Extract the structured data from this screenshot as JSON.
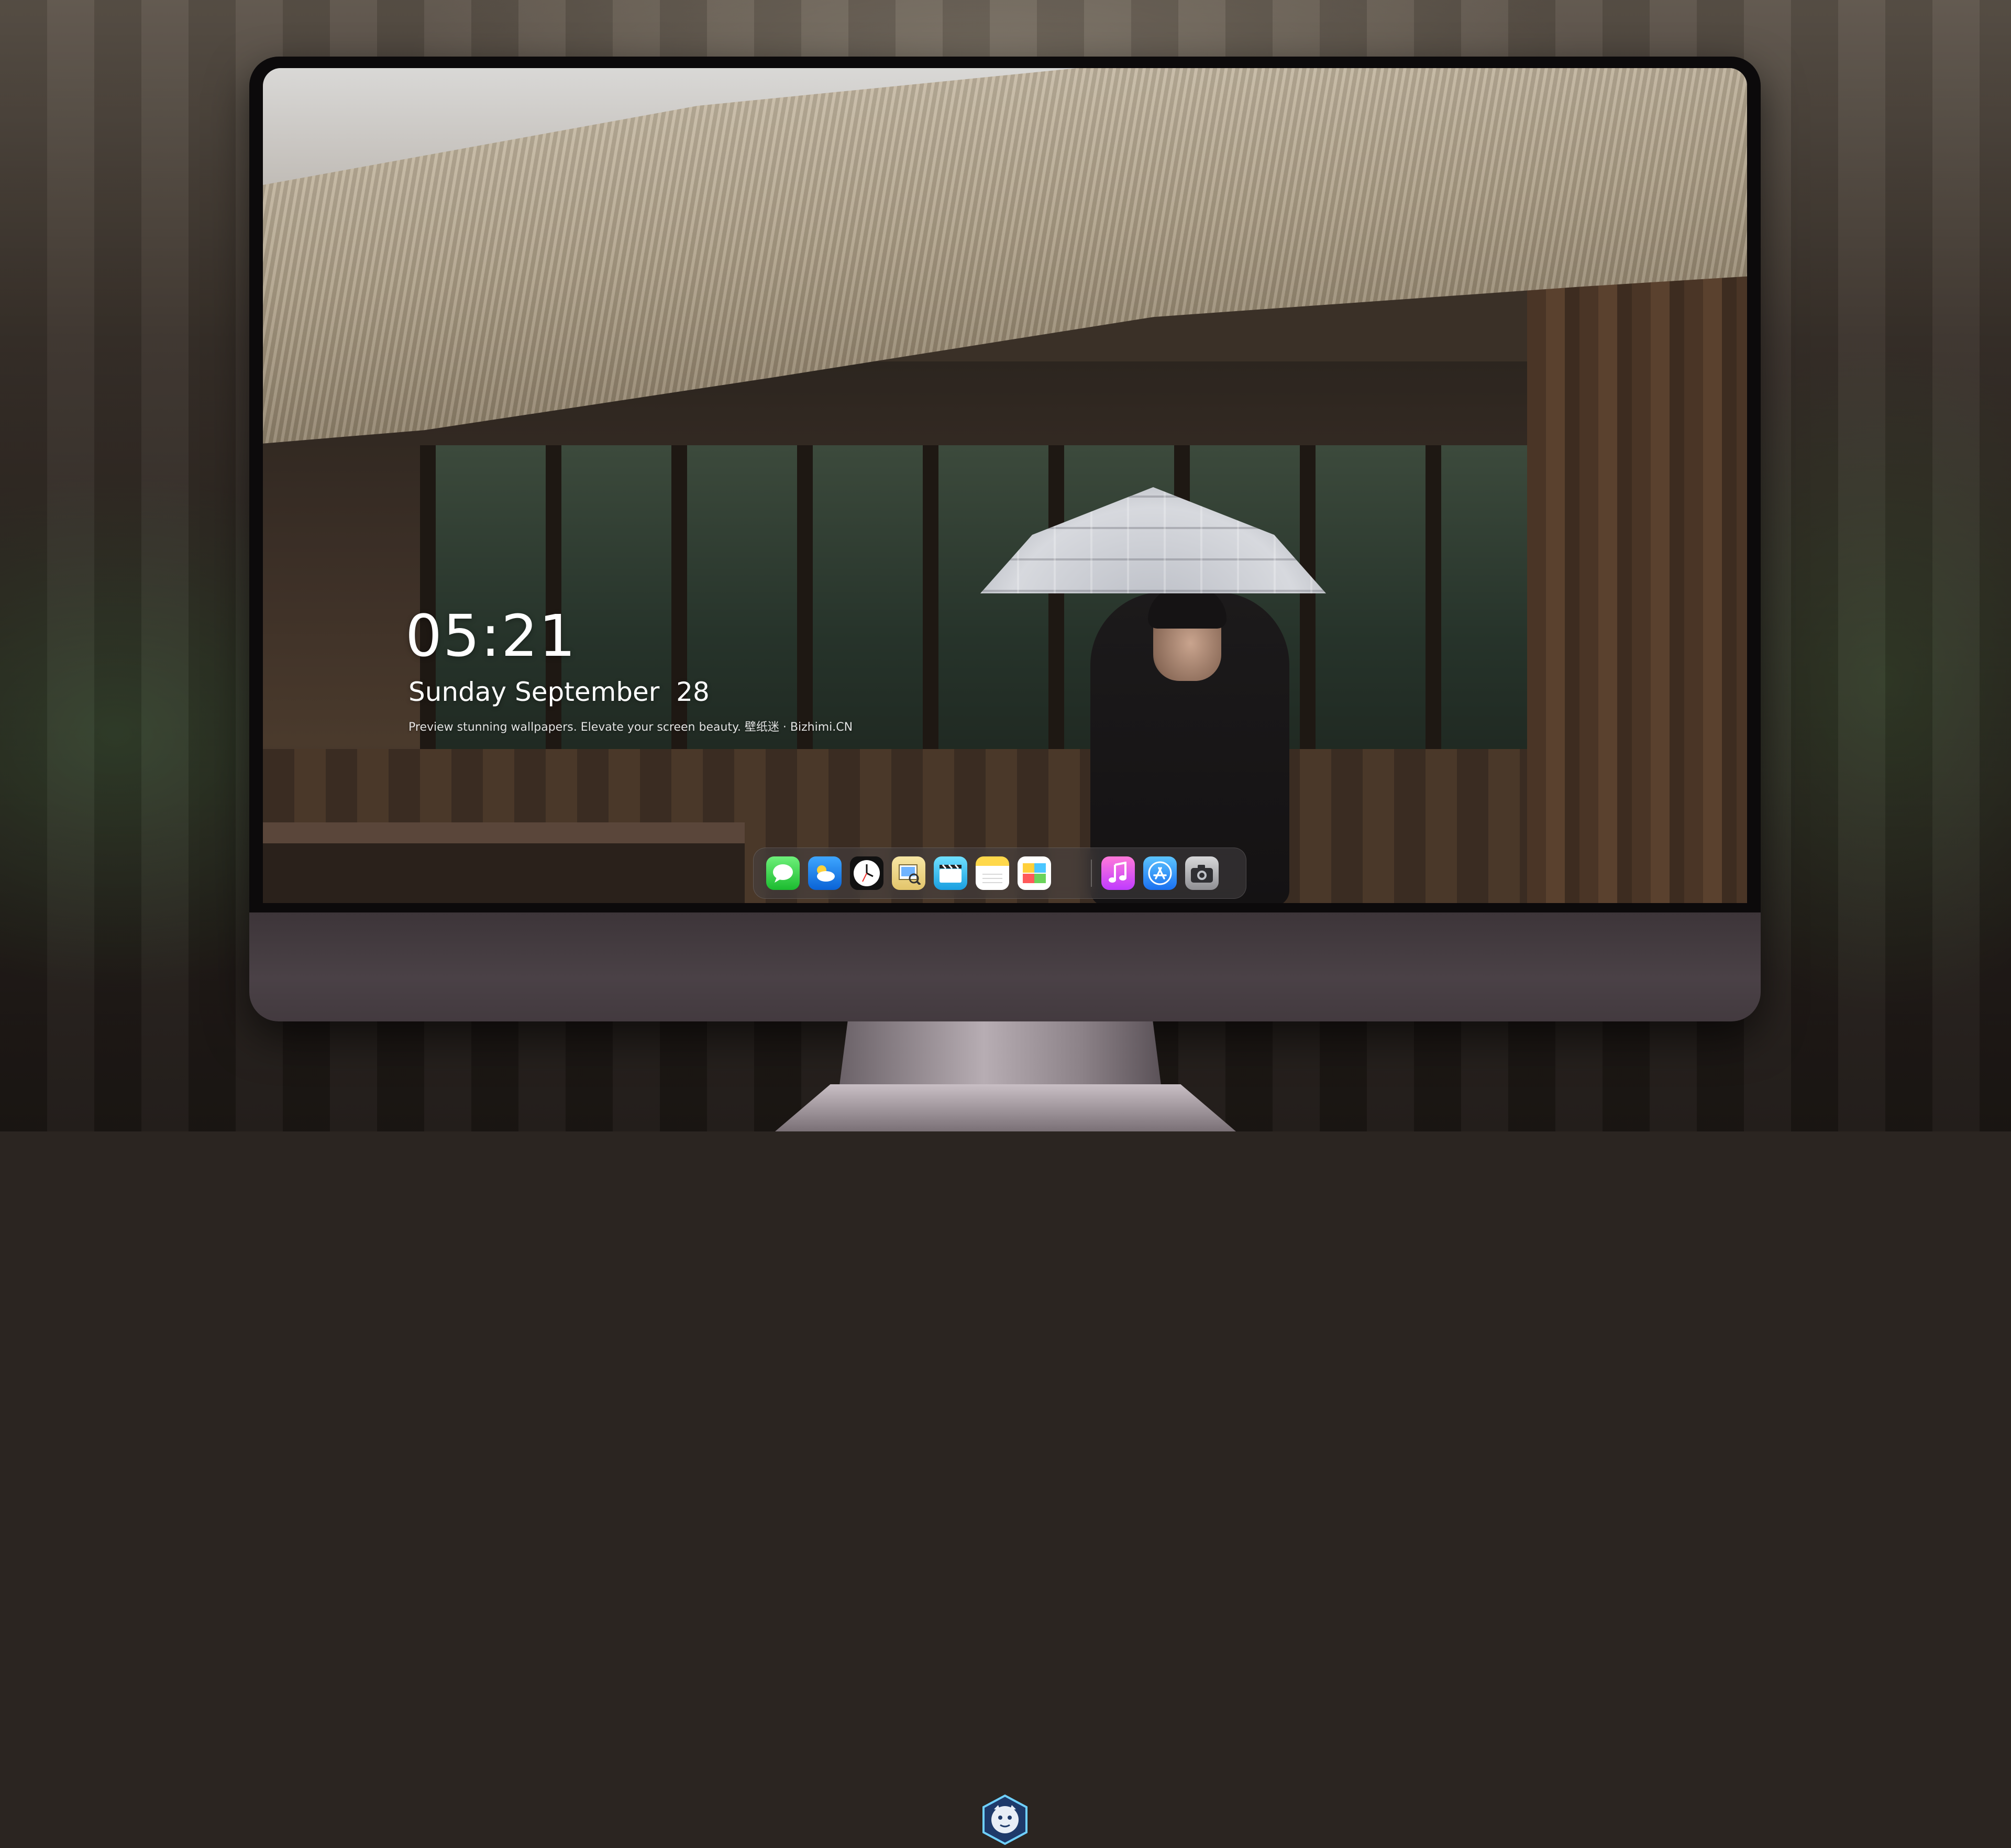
{
  "lockscreen": {
    "time": "05:21",
    "date": "Sunday September  28",
    "tagline": "Preview stunning wallpapers. Elevate your screen beauty. 壁纸迷 · Bizhimi.CN"
  },
  "dock": {
    "apps": [
      {
        "name": "Messages",
        "icon": "messages-icon"
      },
      {
        "name": "Weather",
        "icon": "weather-icon"
      },
      {
        "name": "Clock",
        "icon": "clock-icon"
      },
      {
        "name": "Preview",
        "icon": "preview-icon"
      },
      {
        "name": "Clips",
        "icon": "clips-icon"
      },
      {
        "name": "Notes",
        "icon": "notes-icon"
      },
      {
        "name": "Photos",
        "icon": "photos-icon"
      },
      {
        "name": "Music",
        "icon": "music-icon"
      },
      {
        "name": "App Store",
        "icon": "app-store-icon"
      },
      {
        "name": "Camera",
        "icon": "camera-icon"
      }
    ]
  },
  "monitor": {
    "logo_icon": "bizhimi-mascot-logo-icon"
  },
  "colors": {
    "bezel": "#0c0a0b",
    "chin": "#443b40",
    "dock": "#46424488"
  }
}
